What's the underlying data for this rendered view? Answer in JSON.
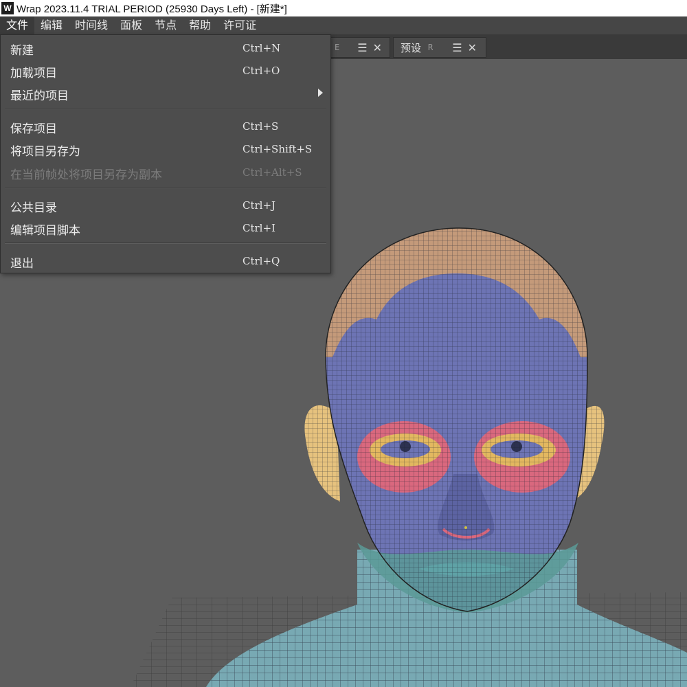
{
  "window": {
    "title": "Wrap 2023.11.4  TRIAL PERIOD (25930 Days Left) - [新建*]",
    "logo": "W"
  },
  "menubar": [
    {
      "label": "文件"
    },
    {
      "label": "编辑"
    },
    {
      "label": "时间线"
    },
    {
      "label": "面板"
    },
    {
      "label": "节点"
    },
    {
      "label": "帮助"
    },
    {
      "label": "许可证"
    }
  ],
  "tabs": {
    "partial_hotkey": "E",
    "presets": {
      "label": "预设",
      "hotkey": "R"
    }
  },
  "icons": {
    "menu": "hamburger-icon",
    "close": "close-icon",
    "submenu": "submenu-arrow-icon"
  },
  "file_menu": {
    "new": {
      "label": "新建",
      "shortcut": "Ctrl+N"
    },
    "load": {
      "label": "加载项目",
      "shortcut": "Ctrl+O"
    },
    "recent": {
      "label": "最近的项目"
    },
    "save": {
      "label": "保存项目",
      "shortcut": "Ctrl+S"
    },
    "save_as": {
      "label": "将项目另存为",
      "shortcut": "Ctrl+Shift+S"
    },
    "save_copy": {
      "label": "在当前帧处将项目另存为副本",
      "shortcut": "Ctrl+Alt+S",
      "disabled": true
    },
    "gallery": {
      "label": "公共目录",
      "shortcut": "Ctrl+J"
    },
    "script": {
      "label": "编辑项目脚本",
      "shortcut": "Ctrl+I"
    },
    "exit": {
      "label": "退出",
      "shortcut": "Ctrl+Q"
    }
  },
  "colors": {
    "background": "#5d5d5d",
    "menu_bg": "#4d4d4d",
    "scalp": "#c49a7a",
    "face": "#6d74b4",
    "eye_region": "#d9687e",
    "eyelid": "#e3b860",
    "ear": "#e6c27e",
    "neck": "#78a9b3",
    "lower_face": "#5b9a96"
  }
}
